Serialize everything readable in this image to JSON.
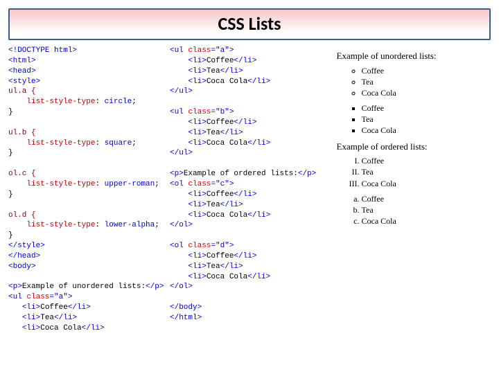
{
  "title": "CSS Lists",
  "code": {
    "doctype": "<!DOCTYPE html>",
    "html_open": "<html>",
    "head_open": "<head>",
    "style_open": "<style>",
    "sel_ul_a": "ul.a {",
    "prop_circle_key": "list-style-type",
    "prop_circle_val": "circle",
    "sel_ul_b": "ul.b {",
    "prop_square_val": "square",
    "sel_ol_c": "ol.c {",
    "prop_uroman_val": "upper-roman",
    "sel_ol_d": "ol.d {",
    "prop_lalpha_val": "lower-alpha",
    "brace_close": "}",
    "style_close": "</style>",
    "head_close": "</head>",
    "body_open": "<body>",
    "body_close": "</body>",
    "html_close": "</html>",
    "p_unordered": "Example of unordered lists:",
    "p_ordered": "Example of ordered lists:",
    "ul_open_a": "<ul class=\"a\">",
    "ul_open_b": "<ul class=\"b\">",
    "ol_open_c": "<ol class=\"c\">",
    "ol_open_d": "<ol class=\"d\">",
    "ul_close": "</ul>",
    "ol_close": "</ol>",
    "li_open": "<li>",
    "li_close": "</li>",
    "p_open": "<p>",
    "p_close": "</p>",
    "semi": ";",
    "colon": ": ",
    "items": {
      "coffee": "Coffee",
      "tea": "Tea",
      "coca": "Coca Cola"
    }
  },
  "output": {
    "heading_unordered": "Example of unordered lists:",
    "heading_ordered": "Example of ordered lists:",
    "items": [
      "Coffee",
      "Tea",
      "Coca Cola"
    ]
  }
}
